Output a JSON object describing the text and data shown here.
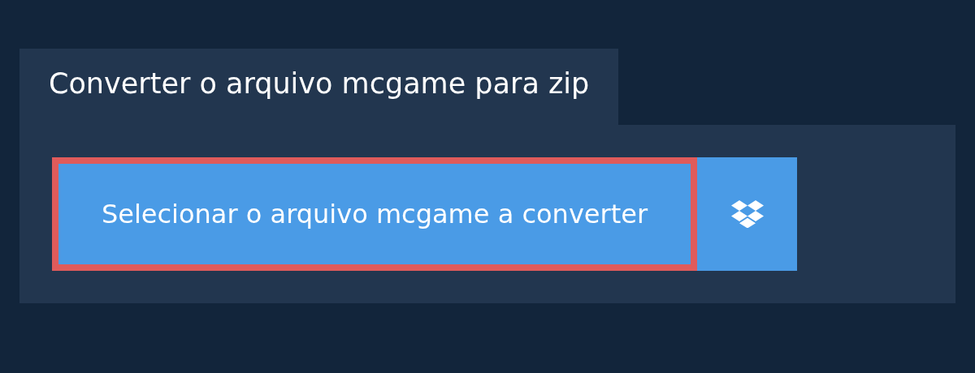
{
  "tab": {
    "title": "Converter o arquivo mcgame para zip"
  },
  "select_button": {
    "label": "Selecionar o arquivo mcgame a converter",
    "focused": true
  }
}
